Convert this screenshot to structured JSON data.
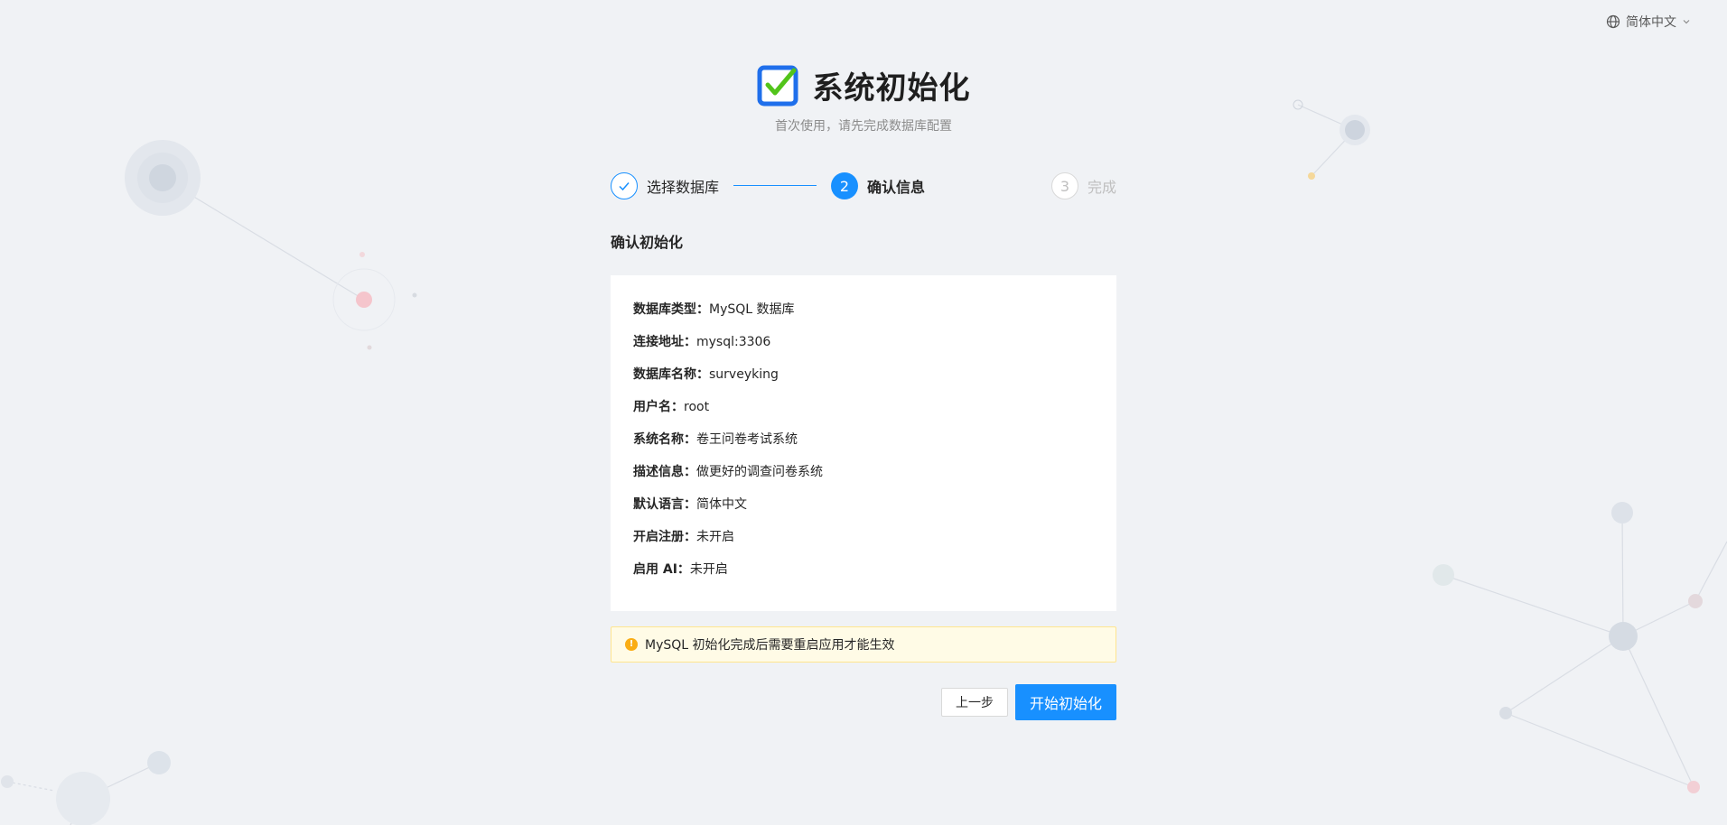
{
  "language_switcher": {
    "label": "简体中文"
  },
  "header": {
    "title": "系统初始化",
    "subtitle": "首次使用，请先完成数据库配置"
  },
  "steps": [
    {
      "index": "1",
      "label": "选择数据库",
      "status": "finished"
    },
    {
      "index": "2",
      "label": "确认信息",
      "status": "current"
    },
    {
      "index": "3",
      "label": "完成",
      "status": "waiting"
    }
  ],
  "section": {
    "title": "确认初始化"
  },
  "info": [
    {
      "label": "数据库类型：",
      "value": "MySQL 数据库"
    },
    {
      "label": "连接地址：",
      "value": "mysql:3306"
    },
    {
      "label": "数据库名称：",
      "value": "surveyking"
    },
    {
      "label": "用户名：",
      "value": "root"
    },
    {
      "label": "系统名称：",
      "value": "卷王问卷考试系统"
    },
    {
      "label": "描述信息：",
      "value": "做更好的调查问卷系统"
    },
    {
      "label": "默认语言：",
      "value": "简体中文"
    },
    {
      "label": "开启注册：",
      "value": "未开启"
    },
    {
      "label": "启用 AI：",
      "value": "未开启"
    }
  ],
  "alert": {
    "text": "MySQL 初始化完成后需要重启应用才能生效"
  },
  "buttons": {
    "prev": "上一步",
    "start": "开始初始化"
  },
  "colors": {
    "primary": "#1890ff",
    "warning": "#faad14",
    "background": "#f0f2f5",
    "logo_check": "#52c41a"
  }
}
